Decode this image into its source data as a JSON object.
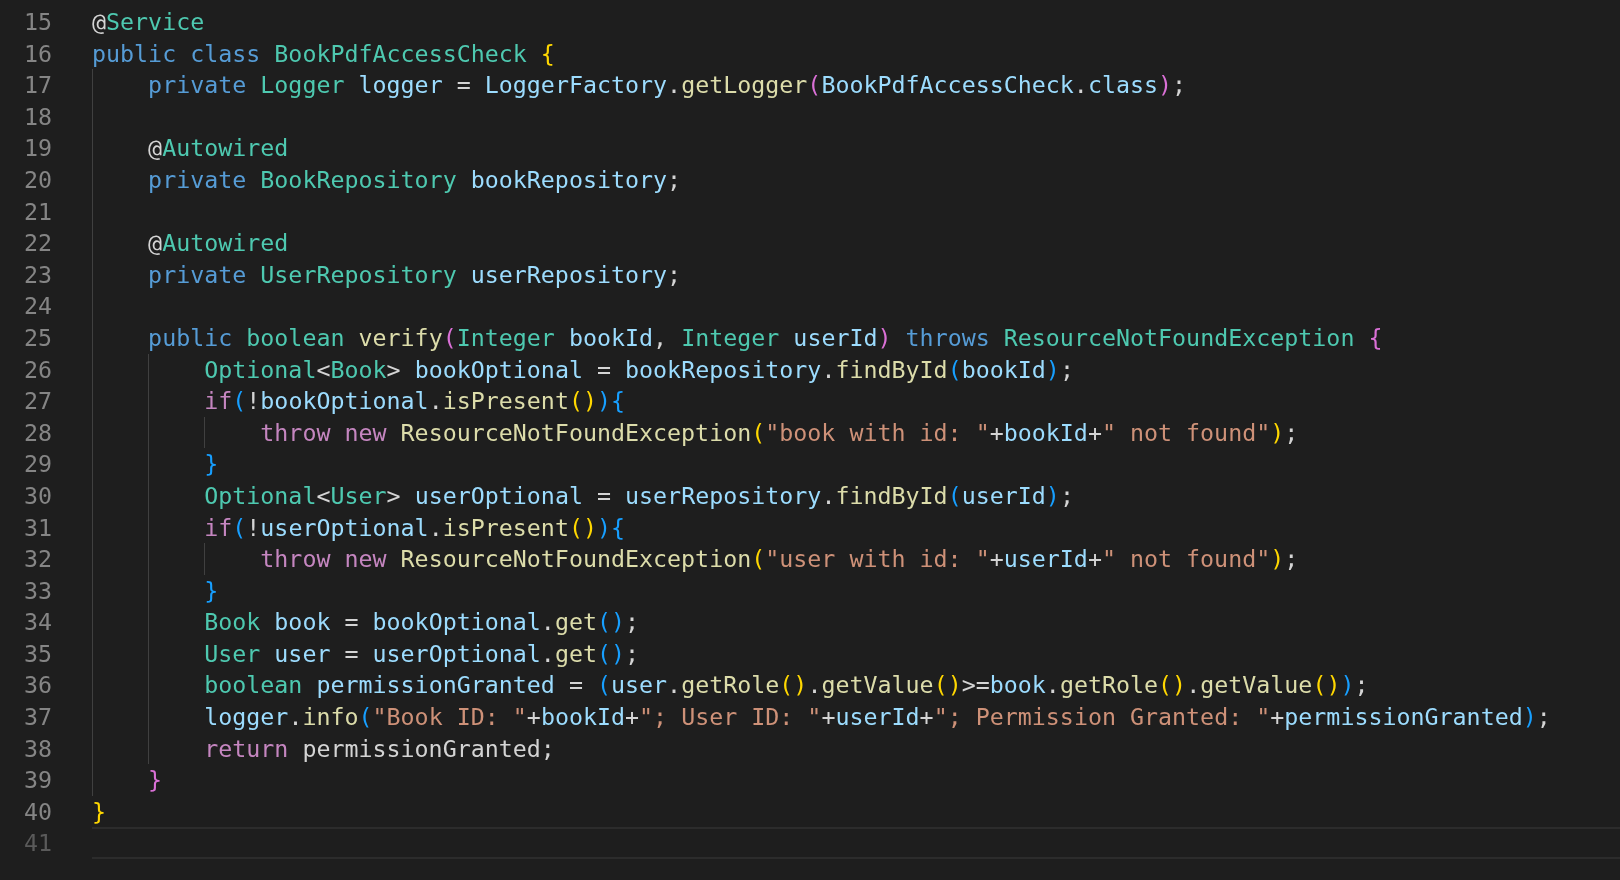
{
  "editor": {
    "lines": [
      {
        "number": "15",
        "current": false,
        "tokens": [
          {
            "text": "@",
            "kind": "plain"
          },
          {
            "text": "Service",
            "kind": "type"
          }
        ]
      },
      {
        "number": "16",
        "current": false,
        "tokens": [
          {
            "text": "public ",
            "kind": "keyword"
          },
          {
            "text": "class ",
            "kind": "keyword"
          },
          {
            "text": "BookPdfAccessCheck ",
            "kind": "type"
          },
          {
            "text": "{",
            "kind": "bracket-gold"
          }
        ]
      },
      {
        "number": "17",
        "current": false,
        "tokens": [
          {
            "text": "    private ",
            "kind": "keyword"
          },
          {
            "text": "Logger ",
            "kind": "type"
          },
          {
            "text": "logger ",
            "kind": "variable"
          },
          {
            "text": "= ",
            "kind": "plain"
          },
          {
            "text": "LoggerFactory",
            "kind": "variable"
          },
          {
            "text": ".",
            "kind": "plain"
          },
          {
            "text": "getLogger",
            "kind": "function"
          },
          {
            "text": "(",
            "kind": "bracket-pink"
          },
          {
            "text": "BookPdfAccessCheck",
            "kind": "variable"
          },
          {
            "text": ".",
            "kind": "plain"
          },
          {
            "text": "class",
            "kind": "variable"
          },
          {
            "text": ")",
            "kind": "bracket-pink"
          },
          {
            "text": ";",
            "kind": "plain"
          }
        ]
      },
      {
        "number": "18",
        "current": false
      },
      {
        "number": "19",
        "current": false,
        "tokens": [
          {
            "text": "    @",
            "kind": "plain"
          },
          {
            "text": "Autowired",
            "kind": "type"
          }
        ]
      },
      {
        "number": "20",
        "current": false,
        "tokens": [
          {
            "text": "    private ",
            "kind": "keyword"
          },
          {
            "text": "BookRepository ",
            "kind": "type"
          },
          {
            "text": "bookRepository",
            "kind": "variable"
          },
          {
            "text": ";",
            "kind": "plain"
          }
        ]
      },
      {
        "number": "21",
        "current": false
      },
      {
        "number": "22",
        "current": false,
        "tokens": [
          {
            "text": "    @",
            "kind": "plain"
          },
          {
            "text": "Autowired",
            "kind": "type"
          }
        ]
      },
      {
        "number": "23",
        "current": false,
        "tokens": [
          {
            "text": "    private ",
            "kind": "keyword"
          },
          {
            "text": "UserRepository ",
            "kind": "type"
          },
          {
            "text": "userRepository",
            "kind": "variable"
          },
          {
            "text": ";",
            "kind": "plain"
          }
        ]
      },
      {
        "number": "24",
        "current": false
      },
      {
        "number": "25",
        "current": false,
        "tokens": [
          {
            "text": "    public ",
            "kind": "keyword"
          },
          {
            "text": "boolean ",
            "kind": "type"
          },
          {
            "text": "verify",
            "kind": "function"
          },
          {
            "text": "(",
            "kind": "bracket-pink"
          },
          {
            "text": "Integer ",
            "kind": "type"
          },
          {
            "text": "bookId",
            "kind": "variable"
          },
          {
            "text": ", ",
            "kind": "plain"
          },
          {
            "text": "Integer ",
            "kind": "type"
          },
          {
            "text": "userId",
            "kind": "variable"
          },
          {
            "text": ") ",
            "kind": "bracket-pink"
          },
          {
            "text": "throws ",
            "kind": "keyword"
          },
          {
            "text": "ResourceNotFoundException ",
            "kind": "type"
          },
          {
            "text": "{",
            "kind": "bracket-pink"
          }
        ]
      },
      {
        "number": "26",
        "current": false,
        "tokens": [
          {
            "text": "        Optional",
            "kind": "type"
          },
          {
            "text": "<",
            "kind": "plain"
          },
          {
            "text": "Book",
            "kind": "type"
          },
          {
            "text": "> ",
            "kind": "plain"
          },
          {
            "text": "bookOptional ",
            "kind": "variable"
          },
          {
            "text": "= ",
            "kind": "plain"
          },
          {
            "text": "bookRepository",
            "kind": "variable"
          },
          {
            "text": ".",
            "kind": "plain"
          },
          {
            "text": "findById",
            "kind": "function"
          },
          {
            "text": "(",
            "kind": "bracket-blue"
          },
          {
            "text": "bookId",
            "kind": "variable"
          },
          {
            "text": ")",
            "kind": "bracket-blue"
          },
          {
            "text": ";",
            "kind": "plain"
          }
        ]
      },
      {
        "number": "27",
        "current": false,
        "tokens": [
          {
            "text": "        if",
            "kind": "control"
          },
          {
            "text": "(",
            "kind": "bracket-blue"
          },
          {
            "text": "!",
            "kind": "plain"
          },
          {
            "text": "bookOptional",
            "kind": "variable"
          },
          {
            "text": ".",
            "kind": "plain"
          },
          {
            "text": "isPresent",
            "kind": "function"
          },
          {
            "text": "()",
            "kind": "bracket-gold"
          },
          {
            "text": "){",
            "kind": "bracket-blue"
          }
        ]
      },
      {
        "number": "28",
        "current": false,
        "tokens": [
          {
            "text": "            throw new ",
            "kind": "control"
          },
          {
            "text": "ResourceNotFoundException",
            "kind": "function"
          },
          {
            "text": "(",
            "kind": "bracket-gold"
          },
          {
            "text": "\"book with id: \"",
            "kind": "string"
          },
          {
            "text": "+",
            "kind": "plain"
          },
          {
            "text": "bookId",
            "kind": "variable"
          },
          {
            "text": "+",
            "kind": "plain"
          },
          {
            "text": "\" not found\"",
            "kind": "string"
          },
          {
            "text": ")",
            "kind": "bracket-gold"
          },
          {
            "text": ";",
            "kind": "plain"
          }
        ]
      },
      {
        "number": "29",
        "current": false,
        "tokens": [
          {
            "text": "        }",
            "kind": "bracket-blue"
          }
        ]
      },
      {
        "number": "30",
        "current": false,
        "tokens": [
          {
            "text": "        Optional",
            "kind": "type"
          },
          {
            "text": "<",
            "kind": "plain"
          },
          {
            "text": "User",
            "kind": "type"
          },
          {
            "text": "> ",
            "kind": "plain"
          },
          {
            "text": "userOptional ",
            "kind": "variable"
          },
          {
            "text": "= ",
            "kind": "plain"
          },
          {
            "text": "userRepository",
            "kind": "variable"
          },
          {
            "text": ".",
            "kind": "plain"
          },
          {
            "text": "findById",
            "kind": "function"
          },
          {
            "text": "(",
            "kind": "bracket-blue"
          },
          {
            "text": "userId",
            "kind": "variable"
          },
          {
            "text": ")",
            "kind": "bracket-blue"
          },
          {
            "text": ";",
            "kind": "plain"
          }
        ]
      },
      {
        "number": "31",
        "current": false,
        "tokens": [
          {
            "text": "        if",
            "kind": "control"
          },
          {
            "text": "(",
            "kind": "bracket-blue"
          },
          {
            "text": "!",
            "kind": "plain"
          },
          {
            "text": "userOptional",
            "kind": "variable"
          },
          {
            "text": ".",
            "kind": "plain"
          },
          {
            "text": "isPresent",
            "kind": "function"
          },
          {
            "text": "()",
            "kind": "bracket-gold"
          },
          {
            "text": "){",
            "kind": "bracket-blue"
          }
        ]
      },
      {
        "number": "32",
        "current": false,
        "tokens": [
          {
            "text": "            throw new ",
            "kind": "control"
          },
          {
            "text": "ResourceNotFoundException",
            "kind": "function"
          },
          {
            "text": "(",
            "kind": "bracket-gold"
          },
          {
            "text": "\"user with id: \"",
            "kind": "string"
          },
          {
            "text": "+",
            "kind": "plain"
          },
          {
            "text": "userId",
            "kind": "variable"
          },
          {
            "text": "+",
            "kind": "plain"
          },
          {
            "text": "\" not found\"",
            "kind": "string"
          },
          {
            "text": ")",
            "kind": "bracket-gold"
          },
          {
            "text": ";",
            "kind": "plain"
          }
        ]
      },
      {
        "number": "33",
        "current": false,
        "tokens": [
          {
            "text": "        }",
            "kind": "bracket-blue"
          }
        ]
      },
      {
        "number": "34",
        "current": false,
        "tokens": [
          {
            "text": "        Book ",
            "kind": "type"
          },
          {
            "text": "book ",
            "kind": "variable"
          },
          {
            "text": "= ",
            "kind": "plain"
          },
          {
            "text": "bookOptional",
            "kind": "variable"
          },
          {
            "text": ".",
            "kind": "plain"
          },
          {
            "text": "get",
            "kind": "function"
          },
          {
            "text": "()",
            "kind": "bracket-blue"
          },
          {
            "text": ";",
            "kind": "plain"
          }
        ]
      },
      {
        "number": "35",
        "current": false,
        "tokens": [
          {
            "text": "        User ",
            "kind": "type"
          },
          {
            "text": "user ",
            "kind": "variable"
          },
          {
            "text": "= ",
            "kind": "plain"
          },
          {
            "text": "userOptional",
            "kind": "variable"
          },
          {
            "text": ".",
            "kind": "plain"
          },
          {
            "text": "get",
            "kind": "function"
          },
          {
            "text": "()",
            "kind": "bracket-blue"
          },
          {
            "text": ";",
            "kind": "plain"
          }
        ]
      },
      {
        "number": "36",
        "current": false,
        "tokens": [
          {
            "text": "        boolean ",
            "kind": "type"
          },
          {
            "text": "permissionGranted ",
            "kind": "variable"
          },
          {
            "text": "= ",
            "kind": "plain"
          },
          {
            "text": "(",
            "kind": "bracket-blue"
          },
          {
            "text": "user",
            "kind": "variable"
          },
          {
            "text": ".",
            "kind": "plain"
          },
          {
            "text": "getRole",
            "kind": "function"
          },
          {
            "text": "()",
            "kind": "bracket-gold"
          },
          {
            "text": ".",
            "kind": "plain"
          },
          {
            "text": "getValue",
            "kind": "function"
          },
          {
            "text": "()",
            "kind": "bracket-gold"
          },
          {
            "text": ">=",
            "kind": "plain"
          },
          {
            "text": "book",
            "kind": "variable"
          },
          {
            "text": ".",
            "kind": "plain"
          },
          {
            "text": "getRole",
            "kind": "function"
          },
          {
            "text": "()",
            "kind": "bracket-gold"
          },
          {
            "text": ".",
            "kind": "plain"
          },
          {
            "text": "getValue",
            "kind": "function"
          },
          {
            "text": "()",
            "kind": "bracket-gold"
          },
          {
            "text": ")",
            "kind": "bracket-blue"
          },
          {
            "text": ";",
            "kind": "plain"
          }
        ]
      },
      {
        "number": "37",
        "current": false,
        "tokens": [
          {
            "text": "        logger",
            "kind": "variable"
          },
          {
            "text": ".",
            "kind": "plain"
          },
          {
            "text": "info",
            "kind": "function"
          },
          {
            "text": "(",
            "kind": "bracket-blue"
          },
          {
            "text": "\"Book ID: \"",
            "kind": "string"
          },
          {
            "text": "+",
            "kind": "plain"
          },
          {
            "text": "bookId",
            "kind": "variable"
          },
          {
            "text": "+",
            "kind": "plain"
          },
          {
            "text": "\"; User ID: \"",
            "kind": "string"
          },
          {
            "text": "+",
            "kind": "plain"
          },
          {
            "text": "userId",
            "kind": "variable"
          },
          {
            "text": "+",
            "kind": "plain"
          },
          {
            "text": "\"; Permission Granted: \"",
            "kind": "string"
          },
          {
            "text": "+",
            "kind": "plain"
          },
          {
            "text": "permissionGranted",
            "kind": "variable"
          },
          {
            "text": ")",
            "kind": "bracket-blue"
          },
          {
            "text": ";",
            "kind": "plain"
          }
        ]
      },
      {
        "number": "38",
        "current": false,
        "tokens": [
          {
            "text": "        return ",
            "kind": "control"
          },
          {
            "text": "permissionGranted",
            "kind": "plain"
          },
          {
            "text": ";",
            "kind": "plain"
          }
        ]
      },
      {
        "number": "39",
        "current": false,
        "tokens": [
          {
            "text": "    }",
            "kind": "bracket-pink"
          }
        ]
      },
      {
        "number": "40",
        "current": false,
        "tokens": [
          {
            "text": "}",
            "kind": "bracket-gold"
          }
        ]
      },
      {
        "number": "41",
        "current": true
      }
    ]
  }
}
